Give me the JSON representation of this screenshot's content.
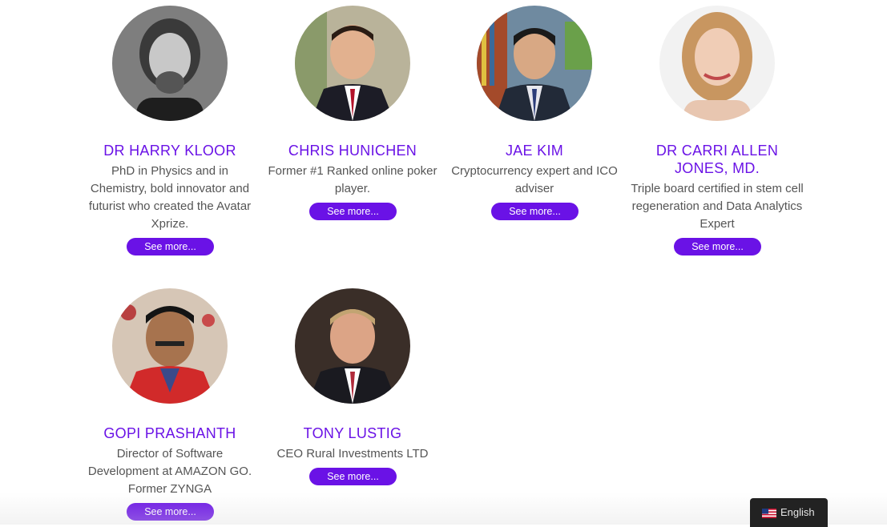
{
  "team": [
    {
      "name": "DR HARRY KLOOR",
      "description": "PhD in Physics and in Chemistry, bold innovator and futurist who created the Avatar Xprize.",
      "button": "See more..."
    },
    {
      "name": "CHRIS HUNICHEN",
      "description": "Former #1 Ranked online poker player.",
      "button": "See more..."
    },
    {
      "name": "JAE KIM",
      "description": "Cryptocurrency expert and ICO adviser",
      "button": "See more..."
    },
    {
      "name": "DR CARRI ALLEN JONES, MD.",
      "description": "Triple board certified in stem cell regeneration and Data Analytics Expert",
      "button": "See more..."
    },
    {
      "name": "GOPI PRASHANTH",
      "description": "Director of Software Development at AMAZON GO. Former ZYNGA",
      "button": "See more..."
    },
    {
      "name": "TONY LUSTIG",
      "description": "CEO Rural Investments LTD",
      "button": "See more..."
    }
  ],
  "language_switcher": {
    "label": "English",
    "flag_icon": "us-flag-icon"
  },
  "colors": {
    "accent": "#6a12e6",
    "text": "#555555",
    "lang_bg": "#222222"
  }
}
